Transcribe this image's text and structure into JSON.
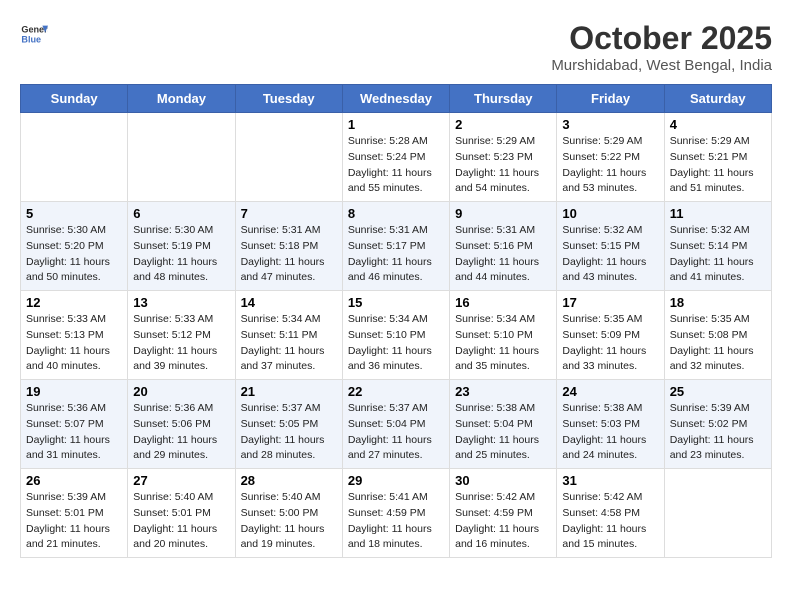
{
  "header": {
    "logo_line1": "General",
    "logo_line2": "Blue",
    "month": "October 2025",
    "location": "Murshidabad, West Bengal, India"
  },
  "days_of_week": [
    "Sunday",
    "Monday",
    "Tuesday",
    "Wednesday",
    "Thursday",
    "Friday",
    "Saturday"
  ],
  "weeks": [
    [
      {
        "day": "",
        "sunrise": "",
        "sunset": "",
        "daylight": ""
      },
      {
        "day": "",
        "sunrise": "",
        "sunset": "",
        "daylight": ""
      },
      {
        "day": "",
        "sunrise": "",
        "sunset": "",
        "daylight": ""
      },
      {
        "day": "1",
        "sunrise": "Sunrise: 5:28 AM",
        "sunset": "Sunset: 5:24 PM",
        "daylight": "Daylight: 11 hours and 55 minutes."
      },
      {
        "day": "2",
        "sunrise": "Sunrise: 5:29 AM",
        "sunset": "Sunset: 5:23 PM",
        "daylight": "Daylight: 11 hours and 54 minutes."
      },
      {
        "day": "3",
        "sunrise": "Sunrise: 5:29 AM",
        "sunset": "Sunset: 5:22 PM",
        "daylight": "Daylight: 11 hours and 53 minutes."
      },
      {
        "day": "4",
        "sunrise": "Sunrise: 5:29 AM",
        "sunset": "Sunset: 5:21 PM",
        "daylight": "Daylight: 11 hours and 51 minutes."
      }
    ],
    [
      {
        "day": "5",
        "sunrise": "Sunrise: 5:30 AM",
        "sunset": "Sunset: 5:20 PM",
        "daylight": "Daylight: 11 hours and 50 minutes."
      },
      {
        "day": "6",
        "sunrise": "Sunrise: 5:30 AM",
        "sunset": "Sunset: 5:19 PM",
        "daylight": "Daylight: 11 hours and 48 minutes."
      },
      {
        "day": "7",
        "sunrise": "Sunrise: 5:31 AM",
        "sunset": "Sunset: 5:18 PM",
        "daylight": "Daylight: 11 hours and 47 minutes."
      },
      {
        "day": "8",
        "sunrise": "Sunrise: 5:31 AM",
        "sunset": "Sunset: 5:17 PM",
        "daylight": "Daylight: 11 hours and 46 minutes."
      },
      {
        "day": "9",
        "sunrise": "Sunrise: 5:31 AM",
        "sunset": "Sunset: 5:16 PM",
        "daylight": "Daylight: 11 hours and 44 minutes."
      },
      {
        "day": "10",
        "sunrise": "Sunrise: 5:32 AM",
        "sunset": "Sunset: 5:15 PM",
        "daylight": "Daylight: 11 hours and 43 minutes."
      },
      {
        "day": "11",
        "sunrise": "Sunrise: 5:32 AM",
        "sunset": "Sunset: 5:14 PM",
        "daylight": "Daylight: 11 hours and 41 minutes."
      }
    ],
    [
      {
        "day": "12",
        "sunrise": "Sunrise: 5:33 AM",
        "sunset": "Sunset: 5:13 PM",
        "daylight": "Daylight: 11 hours and 40 minutes."
      },
      {
        "day": "13",
        "sunrise": "Sunrise: 5:33 AM",
        "sunset": "Sunset: 5:12 PM",
        "daylight": "Daylight: 11 hours and 39 minutes."
      },
      {
        "day": "14",
        "sunrise": "Sunrise: 5:34 AM",
        "sunset": "Sunset: 5:11 PM",
        "daylight": "Daylight: 11 hours and 37 minutes."
      },
      {
        "day": "15",
        "sunrise": "Sunrise: 5:34 AM",
        "sunset": "Sunset: 5:10 PM",
        "daylight": "Daylight: 11 hours and 36 minutes."
      },
      {
        "day": "16",
        "sunrise": "Sunrise: 5:34 AM",
        "sunset": "Sunset: 5:10 PM",
        "daylight": "Daylight: 11 hours and 35 minutes."
      },
      {
        "day": "17",
        "sunrise": "Sunrise: 5:35 AM",
        "sunset": "Sunset: 5:09 PM",
        "daylight": "Daylight: 11 hours and 33 minutes."
      },
      {
        "day": "18",
        "sunrise": "Sunrise: 5:35 AM",
        "sunset": "Sunset: 5:08 PM",
        "daylight": "Daylight: 11 hours and 32 minutes."
      }
    ],
    [
      {
        "day": "19",
        "sunrise": "Sunrise: 5:36 AM",
        "sunset": "Sunset: 5:07 PM",
        "daylight": "Daylight: 11 hours and 31 minutes."
      },
      {
        "day": "20",
        "sunrise": "Sunrise: 5:36 AM",
        "sunset": "Sunset: 5:06 PM",
        "daylight": "Daylight: 11 hours and 29 minutes."
      },
      {
        "day": "21",
        "sunrise": "Sunrise: 5:37 AM",
        "sunset": "Sunset: 5:05 PM",
        "daylight": "Daylight: 11 hours and 28 minutes."
      },
      {
        "day": "22",
        "sunrise": "Sunrise: 5:37 AM",
        "sunset": "Sunset: 5:04 PM",
        "daylight": "Daylight: 11 hours and 27 minutes."
      },
      {
        "day": "23",
        "sunrise": "Sunrise: 5:38 AM",
        "sunset": "Sunset: 5:04 PM",
        "daylight": "Daylight: 11 hours and 25 minutes."
      },
      {
        "day": "24",
        "sunrise": "Sunrise: 5:38 AM",
        "sunset": "Sunset: 5:03 PM",
        "daylight": "Daylight: 11 hours and 24 minutes."
      },
      {
        "day": "25",
        "sunrise": "Sunrise: 5:39 AM",
        "sunset": "Sunset: 5:02 PM",
        "daylight": "Daylight: 11 hours and 23 minutes."
      }
    ],
    [
      {
        "day": "26",
        "sunrise": "Sunrise: 5:39 AM",
        "sunset": "Sunset: 5:01 PM",
        "daylight": "Daylight: 11 hours and 21 minutes."
      },
      {
        "day": "27",
        "sunrise": "Sunrise: 5:40 AM",
        "sunset": "Sunset: 5:01 PM",
        "daylight": "Daylight: 11 hours and 20 minutes."
      },
      {
        "day": "28",
        "sunrise": "Sunrise: 5:40 AM",
        "sunset": "Sunset: 5:00 PM",
        "daylight": "Daylight: 11 hours and 19 minutes."
      },
      {
        "day": "29",
        "sunrise": "Sunrise: 5:41 AM",
        "sunset": "Sunset: 4:59 PM",
        "daylight": "Daylight: 11 hours and 18 minutes."
      },
      {
        "day": "30",
        "sunrise": "Sunrise: 5:42 AM",
        "sunset": "Sunset: 4:59 PM",
        "daylight": "Daylight: 11 hours and 16 minutes."
      },
      {
        "day": "31",
        "sunrise": "Sunrise: 5:42 AM",
        "sunset": "Sunset: 4:58 PM",
        "daylight": "Daylight: 11 hours and 15 minutes."
      },
      {
        "day": "",
        "sunrise": "",
        "sunset": "",
        "daylight": ""
      }
    ]
  ]
}
